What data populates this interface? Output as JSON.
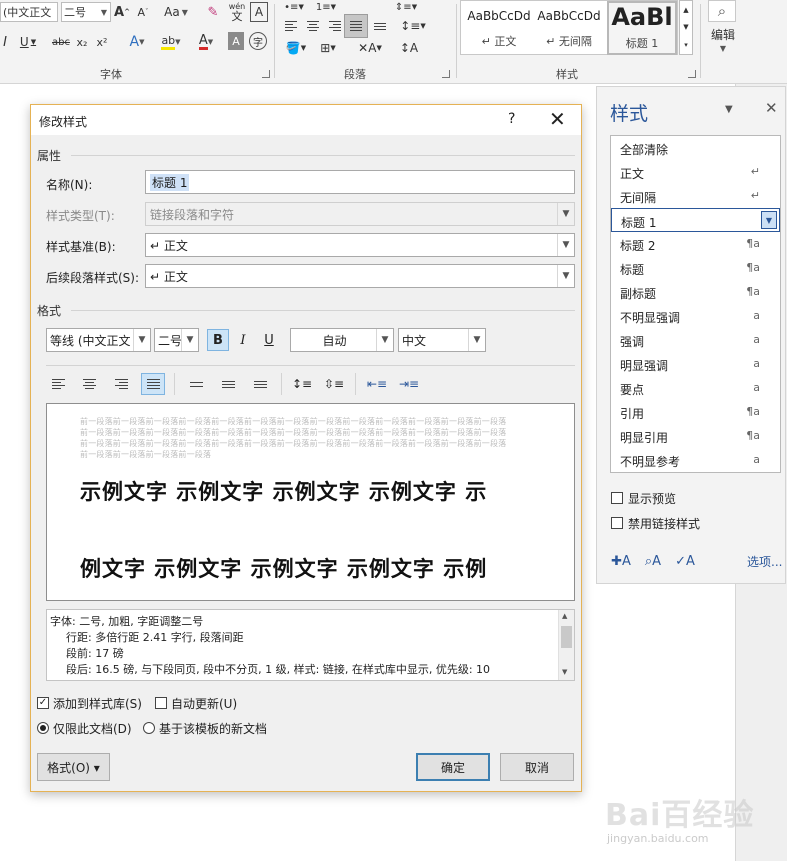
{
  "ribbon": {
    "font_name": "(中文正文",
    "font_size": "二号",
    "font_group_label": "字体",
    "para_group_label": "段落",
    "styles_group_label": "样式",
    "edit_label": "编辑",
    "wen_top": "wén",
    "wen_bottom": "文",
    "aa_label": "Aa",
    "gallery": [
      {
        "sample": "AaBbCcDd",
        "name": "正文"
      },
      {
        "sample": "AaBbCcDd",
        "name": "无间隔"
      },
      {
        "sample": "AaBl",
        "name": "标题 1"
      }
    ]
  },
  "dialog": {
    "title": "修改样式",
    "help": "?",
    "close": "✕",
    "section_properties": "属性",
    "name_label": "名称(N):",
    "name_value": "标题 1",
    "type_label": "样式类型(T):",
    "type_value": "链接段落和字符",
    "based_label": "样式基准(B):",
    "based_value": "↵ 正文",
    "next_label": "后续段落样式(S):",
    "next_value": "↵ 正文",
    "section_format": "格式",
    "font_value": "等线 (中文正文",
    "size_value": "二号",
    "bold": "B",
    "italic": "I",
    "underline": "U",
    "color_value": "自动",
    "lang_value": "中文",
    "preview_prev": [
      "前一段落前一段落前一段落前一段落前一段落前一段落前一段落前一段落前一段落前一段落前一段落前一段落前一段落",
      "前一段落前一段落前一段落前一段落前一段落前一段落前一段落前一段落前一段落前一段落前一段落前一段落前一段落",
      "前一段落前一段落前一段落前一段落前一段落前一段落前一段落前一段落前一段落前一段落前一段落前一段落前一段落",
      "前一段落前一段落前一段落前一段落"
    ],
    "preview_sample": [
      "示例文字  示例文字  示例文字  示例文字  示",
      "例文字  示例文字  示例文字  示例文字  示例"
    ],
    "description": [
      "字体: 二号, 加粗, 字距调整二号",
      "行距: 多倍行距 2.41 字行, 段落间距",
      "段前: 17 磅",
      "段后: 16.5 磅, 与下段同页, 段中不分页, 1 级, 样式: 链接, 在样式库中显示, 优先级: 10"
    ],
    "add_to_gallery": "添加到样式库(S)",
    "auto_update": "自动更新(U)",
    "only_this_doc": "仅限此文档(D)",
    "new_docs_template": "基于该模板的新文档",
    "format_button": "格式(O) ▾",
    "ok_button": "确定",
    "cancel_button": "取消"
  },
  "styles_pane": {
    "title": "样式",
    "items": [
      {
        "name": "全部清除",
        "mark": ""
      },
      {
        "name": "正文",
        "mark": "↵"
      },
      {
        "name": "无间隔",
        "mark": "↵"
      },
      {
        "name": "标题 1",
        "mark": "▼",
        "selected": true
      },
      {
        "name": "标题 2",
        "mark": "¶a"
      },
      {
        "name": "标题",
        "mark": "¶a"
      },
      {
        "name": "副标题",
        "mark": "¶a"
      },
      {
        "name": "不明显强调",
        "mark": "a"
      },
      {
        "name": "强调",
        "mark": "a"
      },
      {
        "name": "明显强调",
        "mark": "a"
      },
      {
        "name": "要点",
        "mark": "a"
      },
      {
        "name": "引用",
        "mark": "¶a"
      },
      {
        "name": "明显引用",
        "mark": "¶a"
      },
      {
        "name": "不明显参考",
        "mark": "a"
      }
    ],
    "show_preview": "显示预览",
    "disable_linked": "禁用链接样式",
    "options_link": "选项..."
  },
  "watermark": {
    "brand": "Bai百经验",
    "url": "jingyan.baidu.com"
  },
  "colors": {
    "accent": "#2b579a",
    "dialog_border": "#e5b254",
    "selection": "#cde4f7"
  }
}
